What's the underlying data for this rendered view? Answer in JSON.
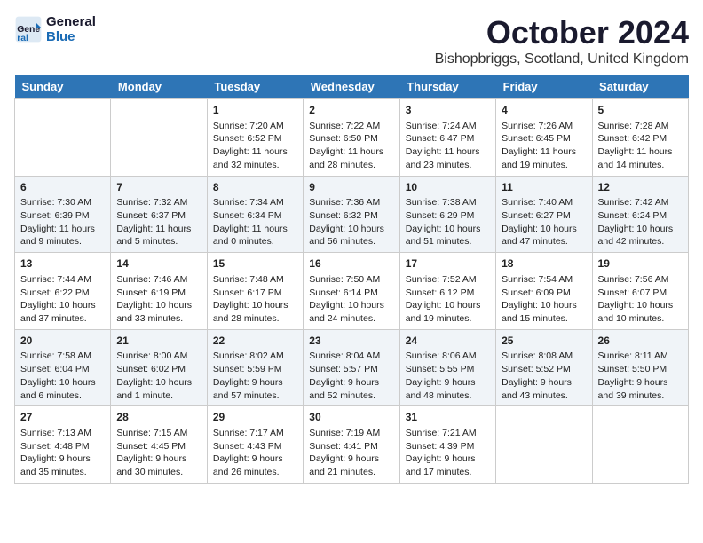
{
  "logo": {
    "line1": "General",
    "line2": "Blue"
  },
  "title": "October 2024",
  "subtitle": "Bishopbriggs, Scotland, United Kingdom",
  "header": {
    "days": [
      "Sunday",
      "Monday",
      "Tuesday",
      "Wednesday",
      "Thursday",
      "Friday",
      "Saturday"
    ]
  },
  "weeks": [
    [
      {
        "day": "",
        "info": ""
      },
      {
        "day": "",
        "info": ""
      },
      {
        "day": "1",
        "info": "Sunrise: 7:20 AM\nSunset: 6:52 PM\nDaylight: 11 hours\nand 32 minutes."
      },
      {
        "day": "2",
        "info": "Sunrise: 7:22 AM\nSunset: 6:50 PM\nDaylight: 11 hours\nand 28 minutes."
      },
      {
        "day": "3",
        "info": "Sunrise: 7:24 AM\nSunset: 6:47 PM\nDaylight: 11 hours\nand 23 minutes."
      },
      {
        "day": "4",
        "info": "Sunrise: 7:26 AM\nSunset: 6:45 PM\nDaylight: 11 hours\nand 19 minutes."
      },
      {
        "day": "5",
        "info": "Sunrise: 7:28 AM\nSunset: 6:42 PM\nDaylight: 11 hours\nand 14 minutes."
      }
    ],
    [
      {
        "day": "6",
        "info": "Sunrise: 7:30 AM\nSunset: 6:39 PM\nDaylight: 11 hours\nand 9 minutes."
      },
      {
        "day": "7",
        "info": "Sunrise: 7:32 AM\nSunset: 6:37 PM\nDaylight: 11 hours\nand 5 minutes."
      },
      {
        "day": "8",
        "info": "Sunrise: 7:34 AM\nSunset: 6:34 PM\nDaylight: 11 hours\nand 0 minutes."
      },
      {
        "day": "9",
        "info": "Sunrise: 7:36 AM\nSunset: 6:32 PM\nDaylight: 10 hours\nand 56 minutes."
      },
      {
        "day": "10",
        "info": "Sunrise: 7:38 AM\nSunset: 6:29 PM\nDaylight: 10 hours\nand 51 minutes."
      },
      {
        "day": "11",
        "info": "Sunrise: 7:40 AM\nSunset: 6:27 PM\nDaylight: 10 hours\nand 47 minutes."
      },
      {
        "day": "12",
        "info": "Sunrise: 7:42 AM\nSunset: 6:24 PM\nDaylight: 10 hours\nand 42 minutes."
      }
    ],
    [
      {
        "day": "13",
        "info": "Sunrise: 7:44 AM\nSunset: 6:22 PM\nDaylight: 10 hours\nand 37 minutes."
      },
      {
        "day": "14",
        "info": "Sunrise: 7:46 AM\nSunset: 6:19 PM\nDaylight: 10 hours\nand 33 minutes."
      },
      {
        "day": "15",
        "info": "Sunrise: 7:48 AM\nSunset: 6:17 PM\nDaylight: 10 hours\nand 28 minutes."
      },
      {
        "day": "16",
        "info": "Sunrise: 7:50 AM\nSunset: 6:14 PM\nDaylight: 10 hours\nand 24 minutes."
      },
      {
        "day": "17",
        "info": "Sunrise: 7:52 AM\nSunset: 6:12 PM\nDaylight: 10 hours\nand 19 minutes."
      },
      {
        "day": "18",
        "info": "Sunrise: 7:54 AM\nSunset: 6:09 PM\nDaylight: 10 hours\nand 15 minutes."
      },
      {
        "day": "19",
        "info": "Sunrise: 7:56 AM\nSunset: 6:07 PM\nDaylight: 10 hours\nand 10 minutes."
      }
    ],
    [
      {
        "day": "20",
        "info": "Sunrise: 7:58 AM\nSunset: 6:04 PM\nDaylight: 10 hours\nand 6 minutes."
      },
      {
        "day": "21",
        "info": "Sunrise: 8:00 AM\nSunset: 6:02 PM\nDaylight: 10 hours\nand 1 minute."
      },
      {
        "day": "22",
        "info": "Sunrise: 8:02 AM\nSunset: 5:59 PM\nDaylight: 9 hours\nand 57 minutes."
      },
      {
        "day": "23",
        "info": "Sunrise: 8:04 AM\nSunset: 5:57 PM\nDaylight: 9 hours\nand 52 minutes."
      },
      {
        "day": "24",
        "info": "Sunrise: 8:06 AM\nSunset: 5:55 PM\nDaylight: 9 hours\nand 48 minutes."
      },
      {
        "day": "25",
        "info": "Sunrise: 8:08 AM\nSunset: 5:52 PM\nDaylight: 9 hours\nand 43 minutes."
      },
      {
        "day": "26",
        "info": "Sunrise: 8:11 AM\nSunset: 5:50 PM\nDaylight: 9 hours\nand 39 minutes."
      }
    ],
    [
      {
        "day": "27",
        "info": "Sunrise: 7:13 AM\nSunset: 4:48 PM\nDaylight: 9 hours\nand 35 minutes."
      },
      {
        "day": "28",
        "info": "Sunrise: 7:15 AM\nSunset: 4:45 PM\nDaylight: 9 hours\nand 30 minutes."
      },
      {
        "day": "29",
        "info": "Sunrise: 7:17 AM\nSunset: 4:43 PM\nDaylight: 9 hours\nand 26 minutes."
      },
      {
        "day": "30",
        "info": "Sunrise: 7:19 AM\nSunset: 4:41 PM\nDaylight: 9 hours\nand 21 minutes."
      },
      {
        "day": "31",
        "info": "Sunrise: 7:21 AM\nSunset: 4:39 PM\nDaylight: 9 hours\nand 17 minutes."
      },
      {
        "day": "",
        "info": ""
      },
      {
        "day": "",
        "info": ""
      }
    ]
  ]
}
